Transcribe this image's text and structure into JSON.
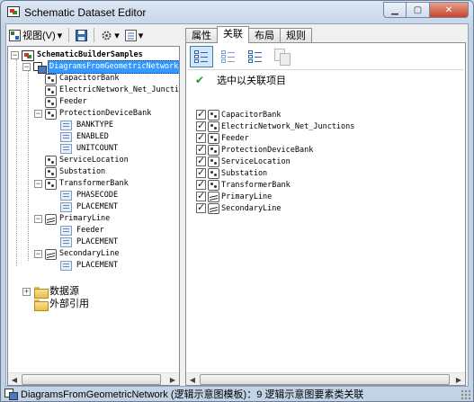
{
  "window": {
    "title": "Schematic Dataset Editor",
    "controls": {
      "minimize": "▁",
      "maximize": "▢",
      "close": "✕"
    }
  },
  "left_toolbar": {
    "view_menu": "视图(V)",
    "view_arrow": "▾",
    "save_icon": "save-icon",
    "settings_arrow": "▾",
    "list_arrow": "▾"
  },
  "tree": {
    "root": "SchematicBuilderSamples",
    "template": "DiagramsFromGeometricNetwork",
    "classes": [
      {
        "label": "CapacitorBank",
        "icon": "node-class-icon",
        "fields": []
      },
      {
        "label": "ElectricNetwork_Net_Junction",
        "icon": "node-class-icon",
        "fields": []
      },
      {
        "label": "Feeder",
        "icon": "node-class-icon",
        "fields": []
      },
      {
        "label": "ProtectionDeviceBank",
        "icon": "node-class-icon",
        "fields": [
          "BANKTYPE",
          "ENABLED",
          "UNITCOUNT"
        ]
      },
      {
        "label": "ServiceLocation",
        "icon": "node-class-icon",
        "fields": []
      },
      {
        "label": "Substation",
        "icon": "node-class-icon",
        "fields": []
      },
      {
        "label": "TransformerBank",
        "icon": "node-class-icon",
        "fields": [
          "PHASECODE",
          "PLACEMENT"
        ]
      },
      {
        "label": "PrimaryLine",
        "icon": "link-class-icon",
        "fields": [
          "Feeder",
          "PLACEMENT"
        ]
      },
      {
        "label": "SecondaryLine",
        "icon": "link-class-icon",
        "fields": [
          "PLACEMENT"
        ]
      }
    ],
    "data_source": "数据源",
    "external_refs": "外部引用"
  },
  "tabs": [
    "属性",
    "关联",
    "布局",
    "规则"
  ],
  "active_tab": 1,
  "associations": {
    "select_label": "选中以关联项目",
    "items": [
      {
        "label": "CapacitorBank",
        "checked": true,
        "icon": "node-class-icon"
      },
      {
        "label": "ElectricNetwork_Net_Junctions",
        "checked": true,
        "icon": "node-class-icon"
      },
      {
        "label": "Feeder",
        "checked": true,
        "icon": "node-class-icon"
      },
      {
        "label": "ProtectionDeviceBank",
        "checked": true,
        "icon": "node-class-icon"
      },
      {
        "label": "ServiceLocation",
        "checked": true,
        "icon": "node-class-icon"
      },
      {
        "label": "Substation",
        "checked": true,
        "icon": "node-class-icon"
      },
      {
        "label": "TransformerBank",
        "checked": true,
        "icon": "node-class-icon"
      },
      {
        "label": "PrimaryLine",
        "checked": true,
        "icon": "link-class-icon"
      },
      {
        "label": "SecondaryLine",
        "checked": true,
        "icon": "link-class-icon"
      }
    ]
  },
  "status": {
    "text": "DiagramsFromGeometricNetwork (逻辑示意图模板)：9 逻辑示意图要素类关联"
  },
  "colors": {
    "selection": "#3399ff",
    "titlebar": "#c3d3e6",
    "close_button": "#c7442b"
  }
}
